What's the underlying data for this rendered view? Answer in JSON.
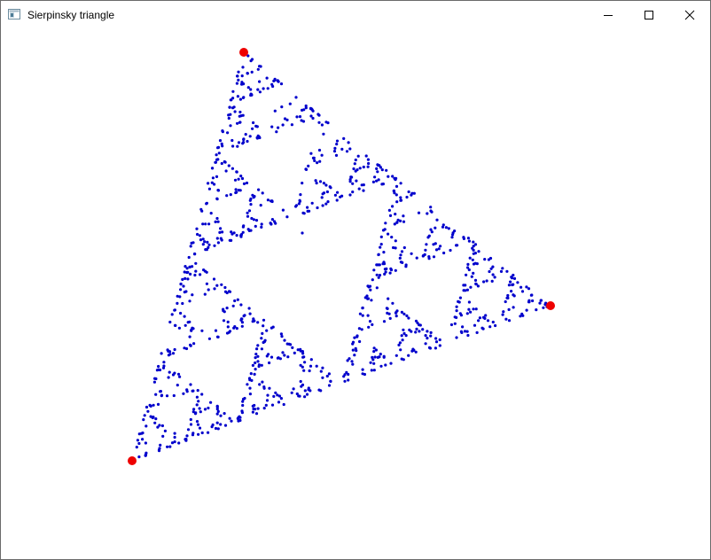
{
  "window": {
    "title": "Sierpinsky triangle",
    "icons": {
      "app": "window-app-icon",
      "minimize": "minimize-icon",
      "maximize": "maximize-icon",
      "close": "close-icon"
    }
  },
  "scene": {
    "point_color": "#0000cc",
    "vertex_color": "#ee0000",
    "background_color": "#ffffff"
  }
}
